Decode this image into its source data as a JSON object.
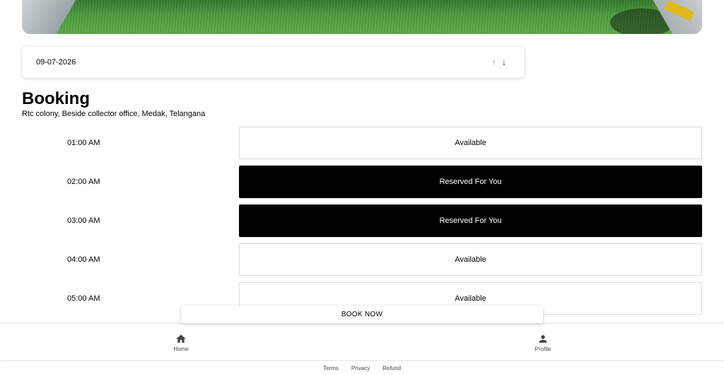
{
  "booking": {
    "date": "09-07-2026",
    "title": "Booking",
    "address": "Rtc colony, Beside collector office, Medak, Telangana"
  },
  "slots": [
    {
      "time": "01:00 AM",
      "status": "Available"
    },
    {
      "time": "02:00 AM",
      "status": "Reserved For You"
    },
    {
      "time": "03:00 AM",
      "status": "Reserved For You"
    },
    {
      "time": "04:00 AM",
      "status": "Available"
    },
    {
      "time": "05:00 AM",
      "status": "Available"
    }
  ],
  "actions": {
    "book_now": "BOOK NOW"
  },
  "nav": {
    "home": "Home",
    "profile": "Profile"
  },
  "footer": {
    "terms": "Terms",
    "privacy": "Privacy",
    "refund": "Refund"
  },
  "colors": {
    "reserved_bg": "#000000",
    "available_bg": "#ffffff"
  },
  "icons": {
    "sort_up": "arrow-up-icon",
    "sort_down": "arrow-down-icon",
    "home": "home-icon",
    "profile": "person-icon"
  }
}
